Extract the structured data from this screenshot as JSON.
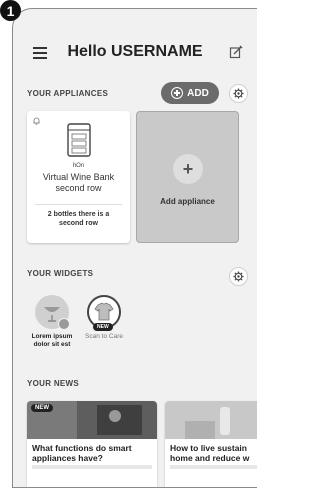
{
  "step_number": "1",
  "header": {
    "greeting": "Hello USERNAME"
  },
  "appliances": {
    "section_title": "YOUR APPLIANCES",
    "add_label": "ADD",
    "card": {
      "brand": "hOn",
      "name_line1": "Virtual Wine Bank",
      "name_line2": "second row",
      "status_line1": "2 bottles there is a",
      "status_line2": "second row"
    },
    "add_card_label": "Add appliance"
  },
  "widgets": {
    "section_title": "YOUR WIDGETS",
    "items": [
      {
        "label_line1": "Lorem ipsum",
        "label_line2": "dolor sit est"
      },
      {
        "label_line1": "Scan to Care",
        "badge": "NEW"
      }
    ]
  },
  "news": {
    "section_title": "YOUR NEWS",
    "items": [
      {
        "badge": "NEW",
        "title_line1": "What functions do smart",
        "title_line2": "appliances have?"
      },
      {
        "title_line1": "How to live sustain",
        "title_line2": "home and reduce w"
      }
    ]
  },
  "colors": {
    "background": "#f1f1f1",
    "add_button": "#6b6b6b",
    "add_card": "#c9c9c9"
  },
  "icons": [
    "menu-icon",
    "edit-icon",
    "gear-icon",
    "bell-icon",
    "wine-fridge-icon",
    "plus-icon",
    "wine-glass-icon",
    "shirt-icon"
  ]
}
